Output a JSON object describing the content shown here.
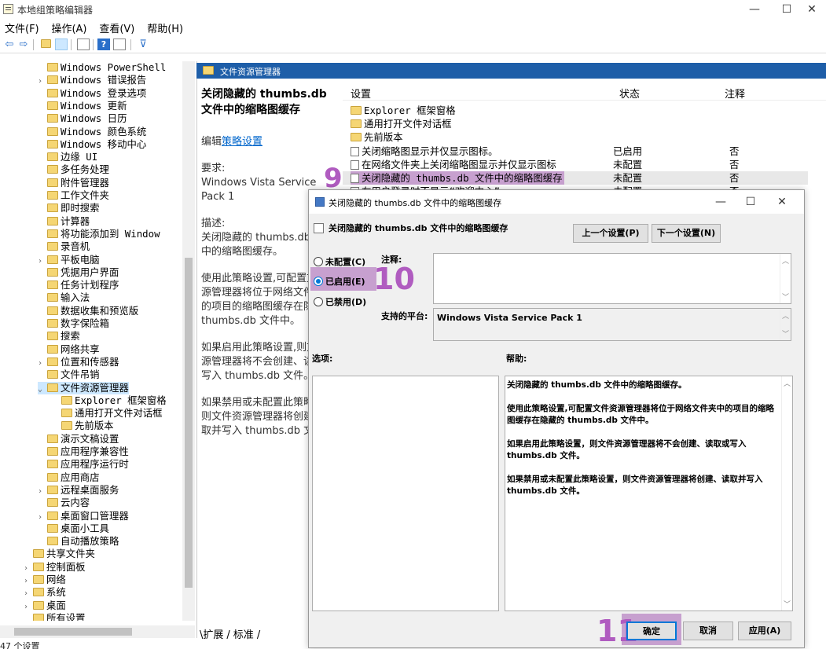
{
  "window": {
    "title": "本地组策略编辑器",
    "minimize": "—",
    "maximize": "☐",
    "close": "✕"
  },
  "menu": [
    "文件(F)",
    "操作(A)",
    "查看(V)",
    "帮助(H)"
  ],
  "toolbar": {
    "back": "⇦",
    "forward": "⇨",
    "filter": "⊽"
  },
  "tree": [
    {
      "label": "Windows PowerShell",
      "indent": 1,
      "exp": ""
    },
    {
      "label": "Windows 错误报告",
      "indent": 1,
      "exp": "›"
    },
    {
      "label": "Windows 登录选项",
      "indent": 1,
      "exp": ""
    },
    {
      "label": "Windows 更新",
      "indent": 1,
      "exp": ""
    },
    {
      "label": "Windows 日历",
      "indent": 1,
      "exp": ""
    },
    {
      "label": "Windows 颜色系统",
      "indent": 1,
      "exp": ""
    },
    {
      "label": "Windows 移动中心",
      "indent": 1,
      "exp": ""
    },
    {
      "label": "边缘 UI",
      "indent": 1,
      "exp": ""
    },
    {
      "label": "多任务处理",
      "indent": 1,
      "exp": ""
    },
    {
      "label": "附件管理器",
      "indent": 1,
      "exp": ""
    },
    {
      "label": "工作文件夹",
      "indent": 1,
      "exp": ""
    },
    {
      "label": "即时搜索",
      "indent": 1,
      "exp": ""
    },
    {
      "label": "计算器",
      "indent": 1,
      "exp": ""
    },
    {
      "label": "将功能添加到 Window",
      "indent": 1,
      "exp": ""
    },
    {
      "label": "录音机",
      "indent": 1,
      "exp": ""
    },
    {
      "label": "平板电脑",
      "indent": 1,
      "exp": "›"
    },
    {
      "label": "凭据用户界面",
      "indent": 1,
      "exp": ""
    },
    {
      "label": "任务计划程序",
      "indent": 1,
      "exp": ""
    },
    {
      "label": "输入法",
      "indent": 1,
      "exp": ""
    },
    {
      "label": "数据收集和预览版",
      "indent": 1,
      "exp": ""
    },
    {
      "label": "数字保险箱",
      "indent": 1,
      "exp": ""
    },
    {
      "label": "搜索",
      "indent": 1,
      "exp": ""
    },
    {
      "label": "网络共享",
      "indent": 1,
      "exp": ""
    },
    {
      "label": "位置和传感器",
      "indent": 1,
      "exp": "›"
    },
    {
      "label": "文件吊销",
      "indent": 1,
      "exp": ""
    },
    {
      "label": "文件资源管理器",
      "indent": 1,
      "exp": "⌄",
      "selected": true
    },
    {
      "label": "Explorer 框架窗格",
      "indent": 2,
      "exp": ""
    },
    {
      "label": "通用打开文件对话框",
      "indent": 2,
      "exp": ""
    },
    {
      "label": "先前版本",
      "indent": 2,
      "exp": ""
    },
    {
      "label": "演示文稿设置",
      "indent": 1,
      "exp": ""
    },
    {
      "label": "应用程序兼容性",
      "indent": 1,
      "exp": ""
    },
    {
      "label": "应用程序运行时",
      "indent": 1,
      "exp": ""
    },
    {
      "label": "应用商店",
      "indent": 1,
      "exp": ""
    },
    {
      "label": "远程桌面服务",
      "indent": 1,
      "exp": "›"
    },
    {
      "label": "云内容",
      "indent": 1,
      "exp": ""
    },
    {
      "label": "桌面窗口管理器",
      "indent": 1,
      "exp": "›"
    },
    {
      "label": "桌面小工具",
      "indent": 1,
      "exp": ""
    },
    {
      "label": "自动播放策略",
      "indent": 1,
      "exp": ""
    },
    {
      "label": "共享文件夹",
      "indent": 0,
      "exp": ""
    },
    {
      "label": "控制面板",
      "indent": 0,
      "exp": "›"
    },
    {
      "label": "网络",
      "indent": 0,
      "exp": "›"
    },
    {
      "label": "系统",
      "indent": 0,
      "exp": "›"
    },
    {
      "label": "桌面",
      "indent": 0,
      "exp": "›"
    },
    {
      "label": "所有设置",
      "indent": 0,
      "exp": ""
    }
  ],
  "pane_header": "文件资源管理器",
  "desc": {
    "title": "关闭隐藏的 thumbs.db 文件中的缩略图缓存",
    "edit_prefix": "编辑",
    "edit_link": "策略设置",
    "req_label": "要求:",
    "req_value": "Windows Vista Service Pack 1",
    "desc_label": "描述:",
    "desc_text": "关闭隐藏的 thumbs.db 文件中的缩略图缓存。",
    "p1": "使用此策略设置,可配置文件资源管理器将位于网络文件夹中的项目的缩略图缓存在隐藏的 thumbs.db 文件中。",
    "p2": "如果启用此策略设置,则文件资源管理器将不会创建、读取或写入 thumbs.db 文件。",
    "p3": "如果禁用或未配置此策略设置,则文件资源管理器将创建、读取并写入 thumbs.db 文件。"
  },
  "list": {
    "headers": [
      "设置",
      "状态",
      "注释"
    ],
    "rows": [
      {
        "name": "Explorer 框架窗格",
        "state": "",
        "note": "",
        "type": "folder"
      },
      {
        "name": "通用打开文件对话框",
        "state": "",
        "note": "",
        "type": "folder"
      },
      {
        "name": "先前版本",
        "state": "",
        "note": "",
        "type": "folder"
      },
      {
        "name": "关闭缩略图显示并仅显示图标。",
        "state": "已启用",
        "note": "否",
        "type": "policy"
      },
      {
        "name": "在网络文件夹上关闭缩略图显示并仅显示图标",
        "state": "未配置",
        "note": "否",
        "type": "policy"
      },
      {
        "name": "关闭隐藏的 thumbs.db 文件中的缩略图缓存",
        "state": "未配置",
        "note": "否",
        "type": "policy",
        "highlight": true
      },
      {
        "name": "在用户登录时不显示“欢迎中心”",
        "state": "未配置",
        "note": "否",
        "type": "policy"
      }
    ]
  },
  "tabs": [
    "扩展",
    "标准"
  ],
  "status": "47 个设置",
  "badges": [
    "9",
    "10",
    "11"
  ],
  "dialog": {
    "title": "关闭隐藏的 thumbs.db 文件中的缩略图缓存",
    "heading": "关闭隐藏的 thumbs.db 文件中的缩略图缓存",
    "prev_btn": "上一个设置(P)",
    "next_btn": "下一个设置(N)",
    "radio_unconfigured": "未配置(C)",
    "radio_enabled": "已启用(E)",
    "radio_disabled": "已禁用(D)",
    "comment_label": "注释:",
    "platform_label": "支持的平台:",
    "platform_value": "Windows Vista Service Pack 1",
    "options_label": "选项:",
    "help_label": "帮助:",
    "help_p1": "关闭隐藏的 thumbs.db 文件中的缩略图缓存。",
    "help_p2": "使用此策略设置,可配置文件资源管理器将位于网络文件夹中的项目的缩略图缓存在隐藏的 thumbs.db 文件中。",
    "help_p3": "如果启用此策略设置，则文件资源管理器将不会创建、读取或写入 thumbs.db 文件。",
    "help_p4": "如果禁用或未配置此策略设置，则文件资源管理器将创建、读取并写入 thumbs.db 文件。",
    "ok": "确定",
    "cancel": "取消",
    "apply": "应用(A)",
    "minimize": "—",
    "maximize": "☐",
    "close": "✕"
  },
  "colors": {
    "accent": "#0078d7",
    "highlight": "#c7a0cf",
    "badge": "#b05cc0",
    "header_bar": "#1e5ea8"
  }
}
